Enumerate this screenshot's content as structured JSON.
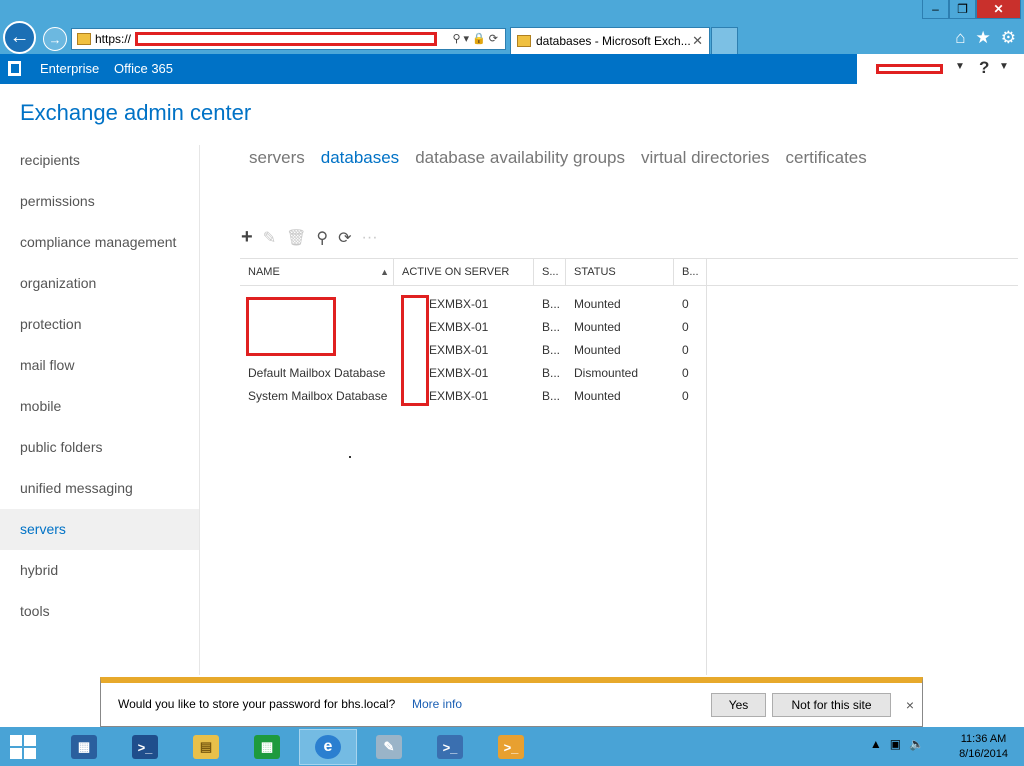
{
  "browser": {
    "address_prefix": "https://",
    "tab_title": "databases - Microsoft Exch...",
    "window_buttons": [
      "‒",
      "❐",
      "✕"
    ]
  },
  "topbar": {
    "enterprise": "Enterprise",
    "office365": "Office 365",
    "help": "?"
  },
  "app_title": "Exchange admin center",
  "sidebar": {
    "items": [
      {
        "label": "recipients"
      },
      {
        "label": "permissions"
      },
      {
        "label": "compliance management"
      },
      {
        "label": "organization"
      },
      {
        "label": "protection"
      },
      {
        "label": "mail flow"
      },
      {
        "label": "mobile"
      },
      {
        "label": "public folders"
      },
      {
        "label": "unified messaging"
      },
      {
        "label": "servers"
      },
      {
        "label": "hybrid"
      },
      {
        "label": "tools"
      }
    ],
    "active": "servers"
  },
  "tabs": [
    {
      "label": "servers"
    },
    {
      "label": "databases"
    },
    {
      "label": "database availability groups"
    },
    {
      "label": "virtual directories"
    },
    {
      "label": "certificates"
    }
  ],
  "active_tab": "databases",
  "toolbar": {
    "add": "+",
    "edit": "✎",
    "delete": "🗑",
    "search": "⚲",
    "refresh": "⟳",
    "more": "···"
  },
  "grid": {
    "columns": [
      "NAME",
      "ACTIVE ON SERVER",
      "S...",
      "STATUS",
      "B..."
    ],
    "sort_indicator": "▲",
    "rows": [
      {
        "name": "",
        "server": "EXMBX-01",
        "s": "B...",
        "status": "Mounted",
        "b": "0"
      },
      {
        "name": "",
        "server": "EXMBX-01",
        "s": "B...",
        "status": "Mounted",
        "b": "0"
      },
      {
        "name": "",
        "server": "EXMBX-01",
        "s": "B...",
        "status": "Mounted",
        "b": "0"
      },
      {
        "name": "Default Mailbox Database",
        "server": "EXMBX-01",
        "s": "B...",
        "status": "Dismounted",
        "b": "0"
      },
      {
        "name": "System Mailbox Database",
        "server": "EXMBX-01",
        "s": "B...",
        "status": "Mounted",
        "b": "0"
      }
    ]
  },
  "prompt": {
    "message": "Would you like to store your password for bhs.local?",
    "more_info": "More info",
    "yes": "Yes",
    "not_for_site": "Not for this site",
    "close": "×"
  },
  "taskbar": {
    "time": "11:36 AM",
    "date": "8/16/2014"
  }
}
